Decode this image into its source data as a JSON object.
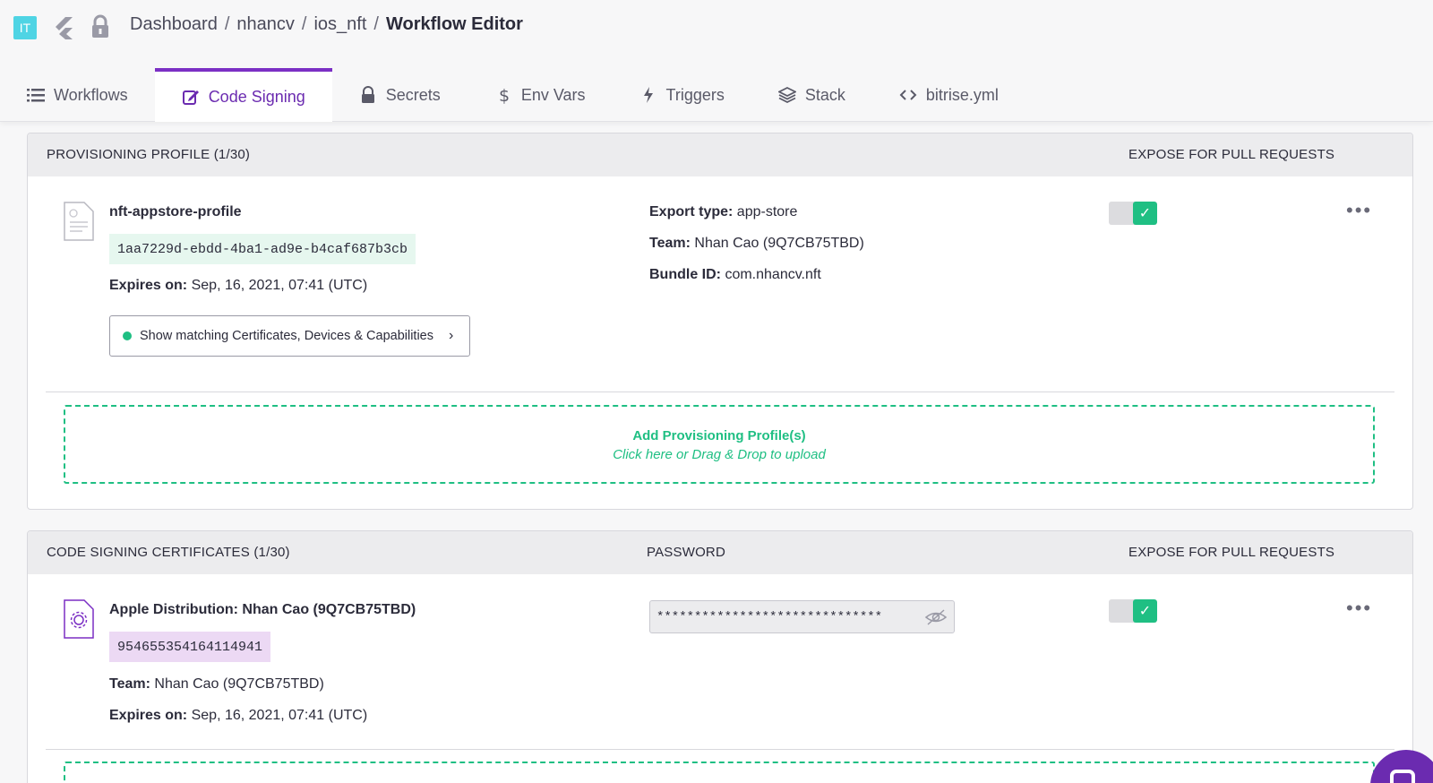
{
  "header": {
    "app_badge": "IT",
    "breadcrumb": [
      "Dashboard",
      "nhancv",
      "ios_nft",
      "Workflow Editor"
    ],
    "separator": "/"
  },
  "tabs": [
    {
      "label": "Workflows",
      "icon": "list-icon"
    },
    {
      "label": "Code Signing",
      "icon": "edit-icon",
      "active": true
    },
    {
      "label": "Secrets",
      "icon": "lock-icon"
    },
    {
      "label": "Env Vars",
      "icon": "dollar-icon"
    },
    {
      "label": "Triggers",
      "icon": "bolt-icon"
    },
    {
      "label": "Stack",
      "icon": "layers-icon"
    },
    {
      "label": "bitrise.yml",
      "icon": "code-icon"
    }
  ],
  "provisioning": {
    "heading": "PROVISIONING PROFILE (1/30)",
    "expose_heading": "EXPOSE FOR PULL REQUESTS",
    "profile": {
      "name": "nft-appstore-profile",
      "uuid": "1aa7229d-ebdd-4ba1-ad9e-b4caf687b3cb",
      "expires_label": "Expires on:",
      "expires_value": "Sep, 16, 2021, 07:41 (UTC)",
      "export_label": "Export type:",
      "export_value": "app-store",
      "team_label": "Team:",
      "team_value": "Nhan Cao (9Q7CB75TBD)",
      "bundle_label": "Bundle ID:",
      "bundle_value": "com.nhancv.nft",
      "match_button": "Show matching Certificates, Devices & Capabilities",
      "expose_enabled": true,
      "more": "•••"
    },
    "dropzone": {
      "title": "Add Provisioning Profile(s)",
      "subtitle": "Click here or Drag & Drop to upload"
    }
  },
  "certificates": {
    "heading": "CODE SIGNING CERTIFICATES (1/30)",
    "password_heading": "PASSWORD",
    "expose_heading": "EXPOSE FOR PULL REQUESTS",
    "cert": {
      "name": "Apple Distribution: Nhan Cao (9Q7CB75TBD)",
      "serial": "954655354164114941",
      "team_label": "Team:",
      "team_value": "Nhan Cao (9Q7CB75TBD)",
      "expires_label": "Expires on:",
      "expires_value": "Sep, 16, 2021, 07:41 (UTC)",
      "password_mask": "******************************",
      "expose_enabled": true,
      "more": "•••"
    }
  },
  "colors": {
    "accent": "#7b2fc4",
    "success": "#1fbf83",
    "badge": "#4fd4e4"
  }
}
